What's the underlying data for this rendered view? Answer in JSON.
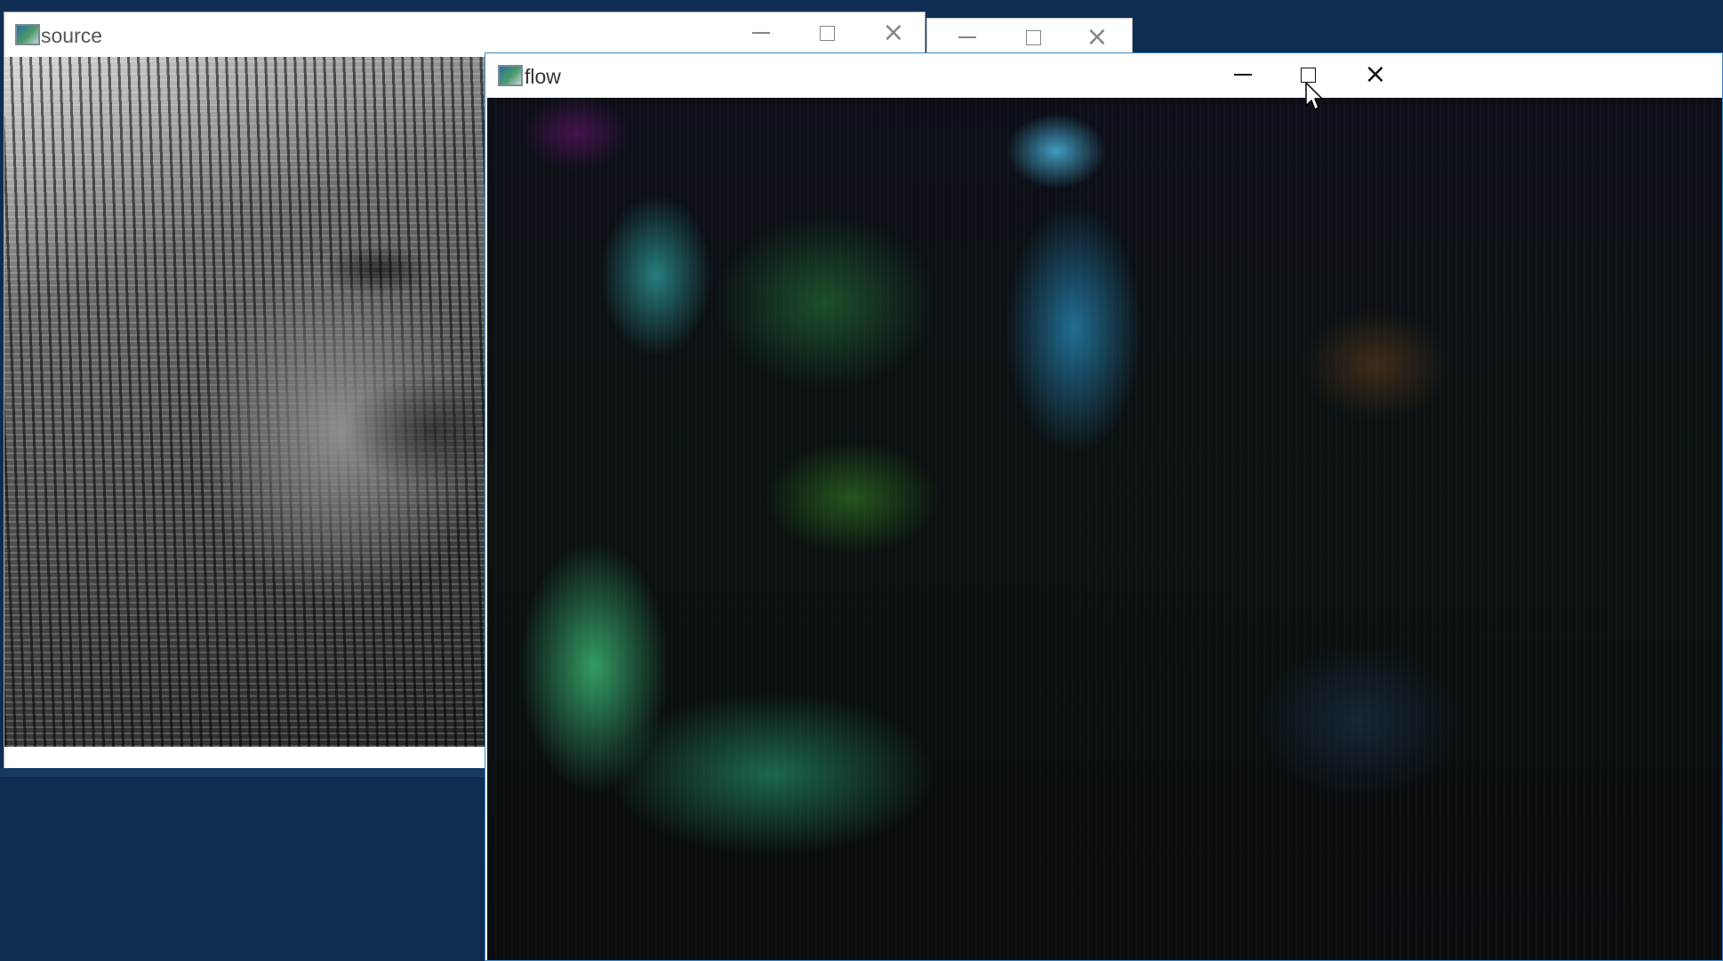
{
  "desktop": {
    "background_color": "#0f2d52"
  },
  "windows": {
    "source": {
      "title": "source",
      "icon": "app-window-icon",
      "content": "grayscale-camera-frame"
    },
    "hidden": {
      "title": "",
      "icon": "none"
    },
    "flow": {
      "title": "flow",
      "icon": "app-window-icon",
      "content": "optical-flow-visualization",
      "focus_border_color": "#3f87c7"
    }
  },
  "controls": {
    "minimize_icon": "minimize-icon",
    "maximize_icon": "maximize-icon",
    "close_icon": "close-icon",
    "close_glyph": "×"
  },
  "pointer": {
    "icon": "mouse-cursor-icon"
  }
}
